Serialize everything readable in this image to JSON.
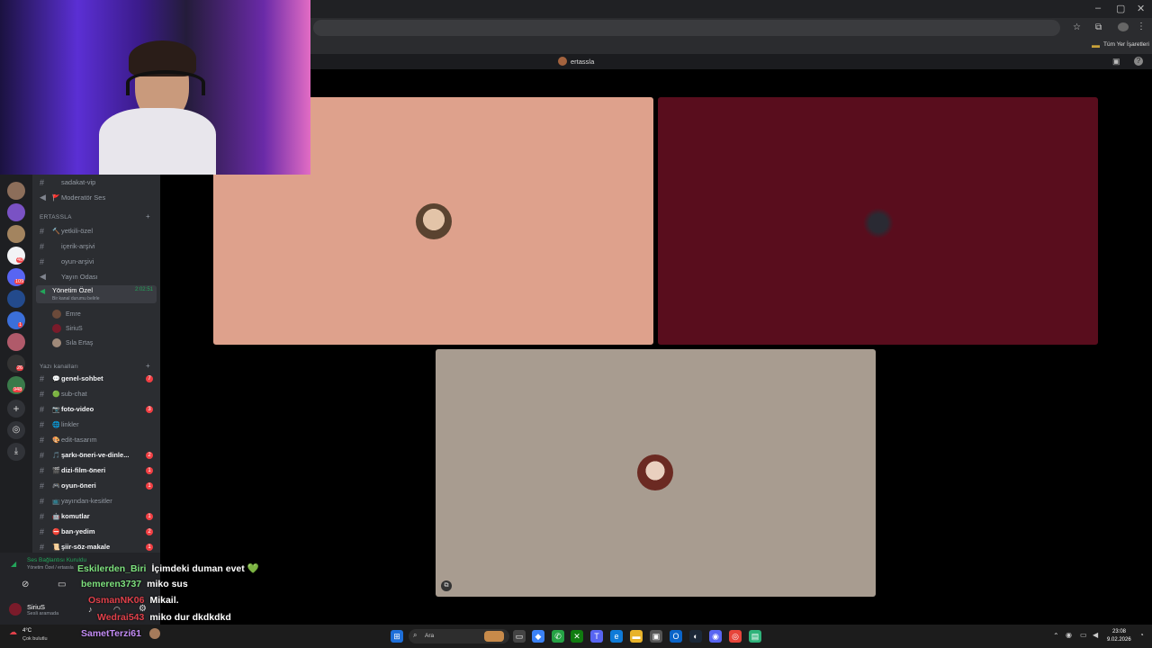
{
  "browser": {
    "bookmarks_label": "Tüm Yer İşaretleri",
    "minimize": "–",
    "maximize": "▢",
    "close": "✕"
  },
  "server": {
    "name": "ertassla"
  },
  "sidebar": {
    "top_channels": [
      {
        "name": "sadakat-vip",
        "emoji": ""
      },
      {
        "name": "Moderatör Ses",
        "emoji": "🚩"
      }
    ],
    "category_ertassla": "ERTASSLA",
    "ertassla_channels": [
      {
        "name": "yetkili-özel",
        "emoji": "🔨"
      },
      {
        "name": "içerik-arşivi",
        "emoji": ""
      },
      {
        "name": "oyun-arşivi",
        "emoji": ""
      },
      {
        "name": "Yayın Odası",
        "emoji": ""
      }
    ],
    "active_voice": {
      "name": "Yönetim Özel",
      "timer": "2:02:51",
      "status": "Bir kanal durumu belirle"
    },
    "voice_users": [
      {
        "name": "Emre"
      },
      {
        "name": "SiriuS"
      },
      {
        "name": "Sıla Ertaş"
      }
    ],
    "category_text": "Yazı kanalları",
    "text_channels": [
      {
        "name": "genel-sohbet",
        "emoji": "💬",
        "unread": true,
        "badge": "7"
      },
      {
        "name": "sub-chat",
        "emoji": "🟢",
        "unread": false,
        "badge": ""
      },
      {
        "name": "foto-video",
        "emoji": "📷",
        "unread": true,
        "badge": "3"
      },
      {
        "name": "linkler",
        "emoji": "🌐",
        "unread": false,
        "badge": ""
      },
      {
        "name": "edit-tasarım",
        "emoji": "🎨",
        "unread": false,
        "badge": ""
      },
      {
        "name": "şarkı-öneri-ve-dinle...",
        "emoji": "🎵",
        "unread": true,
        "badge": "2"
      },
      {
        "name": "dizi-film-öneri",
        "emoji": "🎬",
        "unread": true,
        "badge": "1"
      },
      {
        "name": "oyun-öneri",
        "emoji": "🎮",
        "unread": true,
        "badge": "1"
      },
      {
        "name": "yayından-kesitler",
        "emoji": "📺",
        "unread": false,
        "badge": ""
      },
      {
        "name": "komutlar",
        "emoji": "🤖",
        "unread": true,
        "badge": "1"
      },
      {
        "name": "ban-yedim",
        "emoji": "⛔",
        "unread": true,
        "badge": "2"
      },
      {
        "name": "şiir-söz-makale",
        "emoji": "📜",
        "unread": true,
        "badge": "1"
      }
    ]
  },
  "server_badges": [
    "40",
    "109",
    "1",
    "26",
    "948"
  ],
  "user_panel": {
    "connection": "Ses Bağlantısı Kuruldu",
    "channel": "Yönetim Özel / ertassla",
    "username": "SiriuS",
    "status": "Sesli aramada"
  },
  "chat": [
    {
      "user": "Eskilerden_Biri",
      "color": "#7de07d",
      "msg": "İçimdeki duman evet 💚"
    },
    {
      "user": "bemeren3737",
      "color": "#7de07d",
      "msg": "miko sus"
    },
    {
      "user": "OsmanNK06",
      "color": "#e0404a",
      "msg": "Mikail."
    },
    {
      "user": "Wedrai543",
      "color": "#e0404a",
      "msg": "miko dur dkdkdkd"
    },
    {
      "user": "SametTerzi61",
      "color": "#c38cf5",
      "msg": ""
    }
  ],
  "colors": {
    "tile1": "#dea18c",
    "tile2": "#590d1d",
    "tile3": "#a89c90"
  },
  "taskbar": {
    "weather_temp": "4°C",
    "weather_desc": "Çok bulutlu",
    "search_placeholder": "Ara",
    "time": "23:08",
    "date": "9.02.2026"
  }
}
